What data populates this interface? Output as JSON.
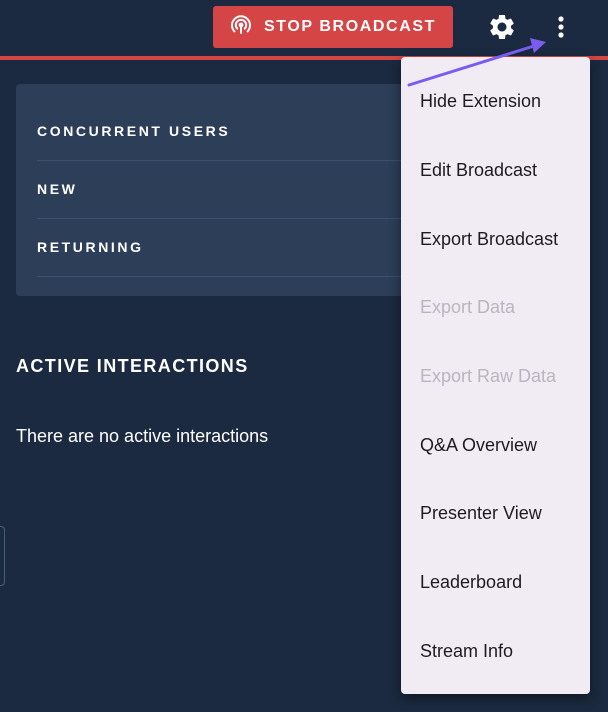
{
  "header": {
    "stop_broadcast_label": "STOP BROADCAST",
    "icons": {
      "broadcast": "broadcast-icon",
      "settings": "gear-icon",
      "more": "kebab-menu-icon"
    }
  },
  "stats": {
    "rows": [
      {
        "label": "CONCURRENT USERS"
      },
      {
        "label": "NEW"
      },
      {
        "label": "RETURNING"
      }
    ]
  },
  "interactions": {
    "title": "ACTIVE INTERACTIONS",
    "empty_text": "There are no active interactions"
  },
  "menu": {
    "items": [
      {
        "label": "Hide Extension",
        "enabled": true
      },
      {
        "label": "Edit Broadcast",
        "enabled": true
      },
      {
        "label": "Export Broadcast",
        "enabled": true
      },
      {
        "label": "Export Data",
        "enabled": false
      },
      {
        "label": "Export Raw Data",
        "enabled": false
      },
      {
        "label": "Q&A Overview",
        "enabled": true
      },
      {
        "label": "Presenter View",
        "enabled": true
      },
      {
        "label": "Leaderboard",
        "enabled": true
      },
      {
        "label": "Stream Info",
        "enabled": true
      }
    ]
  },
  "colors": {
    "background": "#1b2a40",
    "card": "#2c3e58",
    "accent_red": "#d64545",
    "menu_bg": "#f1ecf4",
    "menu_text": "#1d1b20",
    "menu_disabled_text": "#b9b4bf",
    "annotation_arrow": "#7b5cf0"
  }
}
